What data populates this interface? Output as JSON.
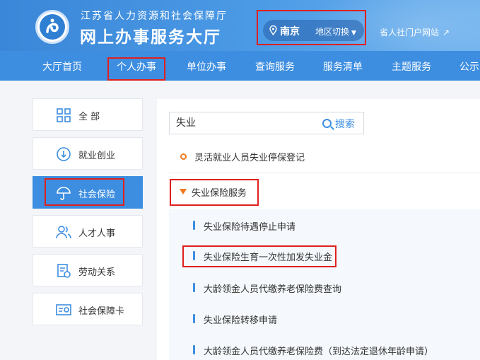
{
  "header": {
    "org_name": "江苏省人力资源和社会保障厅",
    "site_title": "网上办事服务大厅",
    "region_city": "南京",
    "region_switch": "地区切换",
    "portal_link": "省人社门户网站"
  },
  "nav": {
    "items": [
      "大厅首页",
      "个人办事",
      "单位办事",
      "查询服务",
      "服务清单",
      "主题服务",
      "公示"
    ],
    "active": "个人办事"
  },
  "sidebar": {
    "items": [
      {
        "label": "全 部",
        "icon": "grid-icon"
      },
      {
        "label": "就业创业",
        "icon": "employment-icon"
      },
      {
        "label": "社会保险",
        "icon": "umbrella-icon",
        "active": true
      },
      {
        "label": "人才人事",
        "icon": "people-icon"
      },
      {
        "label": "劳动关系",
        "icon": "document-icon"
      },
      {
        "label": "社会保障卡",
        "icon": "card-icon"
      }
    ]
  },
  "search": {
    "value": "失业",
    "button_label": "搜索"
  },
  "results": {
    "flexible_item": "灵活就业人员失业停保登记",
    "category": "失业保险服务",
    "sub_items": [
      "失业保险待遇停止申请",
      "失业保险生育一次性加发失业金",
      "大龄领金人员代缴养老保险费查询",
      "失业保险转移申请",
      "大龄领金人员代缴养老保险费（到达法定退休年龄申请）"
    ]
  },
  "colors": {
    "primary": "#3d8ee0",
    "highlight_border": "#e0201e",
    "accent_orange": "#f07a1f"
  }
}
